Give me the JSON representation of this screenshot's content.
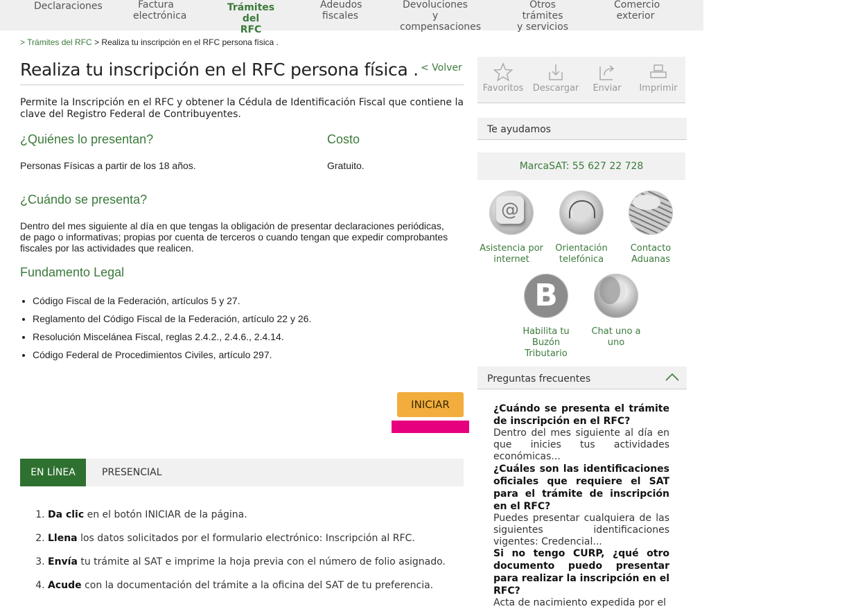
{
  "nav": {
    "items": [
      {
        "label_1": "Declaraciones",
        "label_2": ""
      },
      {
        "label_1": "Factura",
        "label_2": "electrónica"
      },
      {
        "label_1": "Trámites del",
        "label_2": "RFC"
      },
      {
        "label_1": "Adeudos",
        "label_2": "fiscales"
      },
      {
        "label_1": "Devoluciones y",
        "label_2": "compensaciones"
      },
      {
        "label_1": "Otros trámites",
        "label_2": "y servicios"
      },
      {
        "label_1": "Comercio",
        "label_2": "exterior"
      }
    ]
  },
  "breadcrumb": {
    "sep": ">",
    "parent": "Trámites del RFC",
    "current": "Realiza tu inscripción en el RFC persona física ."
  },
  "page": {
    "title": "Realiza tu inscripción en el RFC persona física .",
    "back": "< Volver",
    "intro": "Permite la Inscripción en el RFC y obtener la Cédula de Identificación Fiscal que contiene la clave del Registro Federal de Contribuyentes.",
    "who_heading": "¿Quiénes lo presentan?",
    "who_text": "Personas Físicas a partir de los 18 años.",
    "cost_heading": "Costo",
    "cost_text": "Gratuito.",
    "when_heading": "¿Cuándo se presenta?",
    "when_text": "Dentro del mes siguiente al día en que tengas la obligación de presentar declaraciones periódicas, de pago o informativas; propias por cuenta de terceros o cuando tengan que expedir comprobantes fiscales por las actividades que realicen.",
    "legal_heading": "Fundamento Legal",
    "legal_items": [
      "Código Fiscal de la Federación, artículos 5 y 27.",
      " Reglamento del Código Fiscal de la Federación, artículo 22 y 26.",
      " Resolución Miscelánea Fiscal, reglas 2.4.2., 2.4.6., 2.4.14.",
      "Código Federal de Procedimientos Civiles, artículo 297."
    ],
    "start_button": "INICIAR"
  },
  "tabs": {
    "online": "EN LÍNEA",
    "inperson": "PRESENCIAL"
  },
  "steps": [
    {
      "bold": "Da clic",
      "rest": " en el botón INICIAR de la página."
    },
    {
      "bold": "Llena",
      "rest": " los datos solicitados por el formulario electrónico: Inscripción al RFC."
    },
    {
      "bold": "Envía",
      "rest": " tu trámite al SAT e imprime la hoja previa con el número de folio asignado."
    },
    {
      "bold": "Acude",
      "rest": " con la documentación del trámite a la oficina del SAT de tu preferencia."
    }
  ],
  "toolbar": {
    "favorites": "Favoritos",
    "download": "Descargar",
    "send": "Enviar",
    "print": "Imprimir"
  },
  "help": {
    "heading": "Te ayudamos",
    "phone": "MarcaSAT: 55 627 22 728",
    "items": [
      {
        "l1": "Asistencia por",
        "l2": "internet",
        "icon": "at-sign-icon"
      },
      {
        "l1": "Orientación",
        "l2": "telefónica",
        "icon": "headset-agent-icon"
      },
      {
        "l1": "Contacto",
        "l2": "Aduanas",
        "icon": "keyboard-hand-icon"
      },
      {
        "l1": "Habilita tu",
        "l2": "Buzón Tributario",
        "icon": "buzon-b-icon"
      },
      {
        "l1": "Chat uno a",
        "l2": "uno",
        "icon": "chat-agent-icon"
      }
    ]
  },
  "faq": {
    "heading": "Preguntas frecuentes",
    "items": [
      {
        "q": "¿Cuándo se presenta el trámite de inscripción en el RFC?",
        "a": "Dentro del mes siguiente al día en que inicies tus actividades económicas..."
      },
      {
        "q": "¿Cuáles son las identificaciones oficiales que requiere el SAT para el trámite de inscripción en el RFC?",
        "a": "Puedes presentar cualquiera de las siguientes identificaciones vigentes: Credencial..."
      },
      {
        "q": "Si no tengo CURP, ¿qué otro documento puedo presentar para realizar la inscripción en el RFC?",
        "a": "Acta de nacimiento expedida por el"
      }
    ]
  },
  "colors": {
    "accent_green": "#3b7a3b",
    "tab_active": "#2e7030",
    "button_orange": "#f2ad3d",
    "marker_pink": "#e6007e"
  }
}
